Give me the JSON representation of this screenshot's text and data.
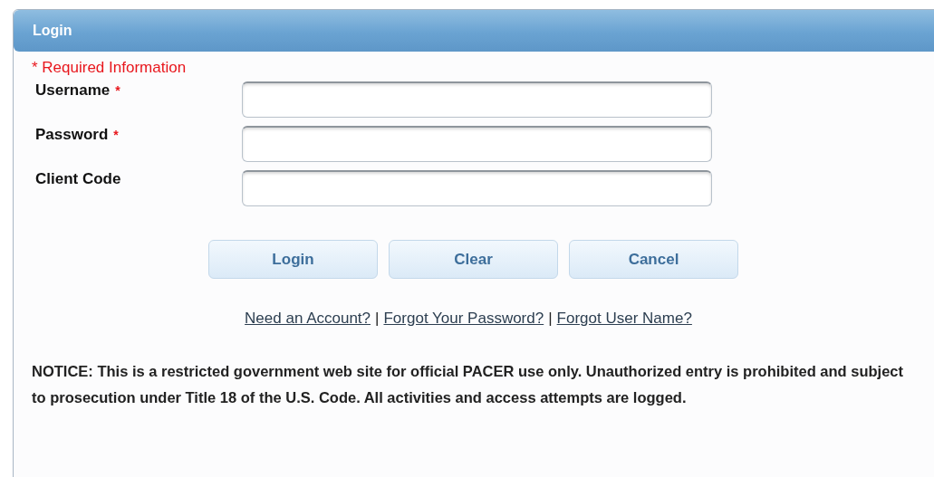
{
  "panel": {
    "title": "Login"
  },
  "required_note": "* Required Information",
  "fields": [
    {
      "label": "Username",
      "marker": "*"
    },
    {
      "label": "Password",
      "marker": "*"
    },
    {
      "label": "Client Code"
    }
  ],
  "buttons": [
    "Login",
    "Clear",
    "Cancel"
  ],
  "links": [
    "Need an Account?",
    "Forgot Your Password?",
    "Forgot User Name?"
  ],
  "link_separator": "|",
  "notice": "NOTICE: This is a restricted government web site for official PACER use only. Unauthorized entry is prohibited and subject to prosecution under Title 18 of the U.S. Code. All activities and access attempts are logged."
}
